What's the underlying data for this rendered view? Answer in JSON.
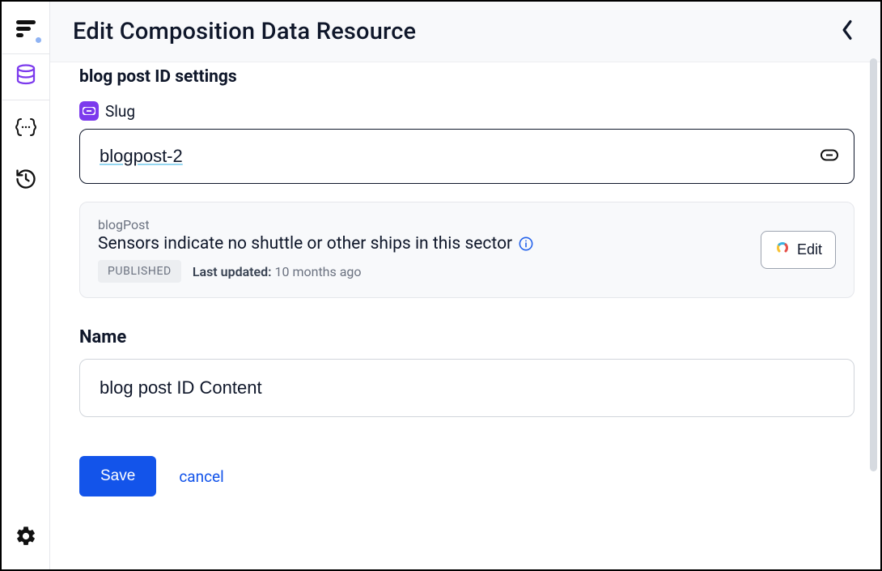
{
  "header": {
    "title": "Edit Composition Data Resource"
  },
  "section": {
    "title": "blog post ID settings"
  },
  "slug": {
    "label": "Slug",
    "value": "blogpost-2"
  },
  "preview": {
    "type": "blogPost",
    "title": "Sensors indicate no shuttle or other ships in this sector",
    "status": "PUBLISHED",
    "last_updated_label": "Last updated:",
    "last_updated_value": "10 months ago",
    "edit_label": "Edit"
  },
  "name": {
    "label": "Name",
    "value": "blog post ID Content"
  },
  "actions": {
    "save": "Save",
    "cancel": "cancel"
  },
  "icons": {
    "logo": "logo",
    "data": "database",
    "json": "json-braces",
    "history": "history",
    "settings": "gear",
    "link": "link",
    "info": "info",
    "contentful": "contentful-logo",
    "chevron_left": "chevron-left"
  }
}
